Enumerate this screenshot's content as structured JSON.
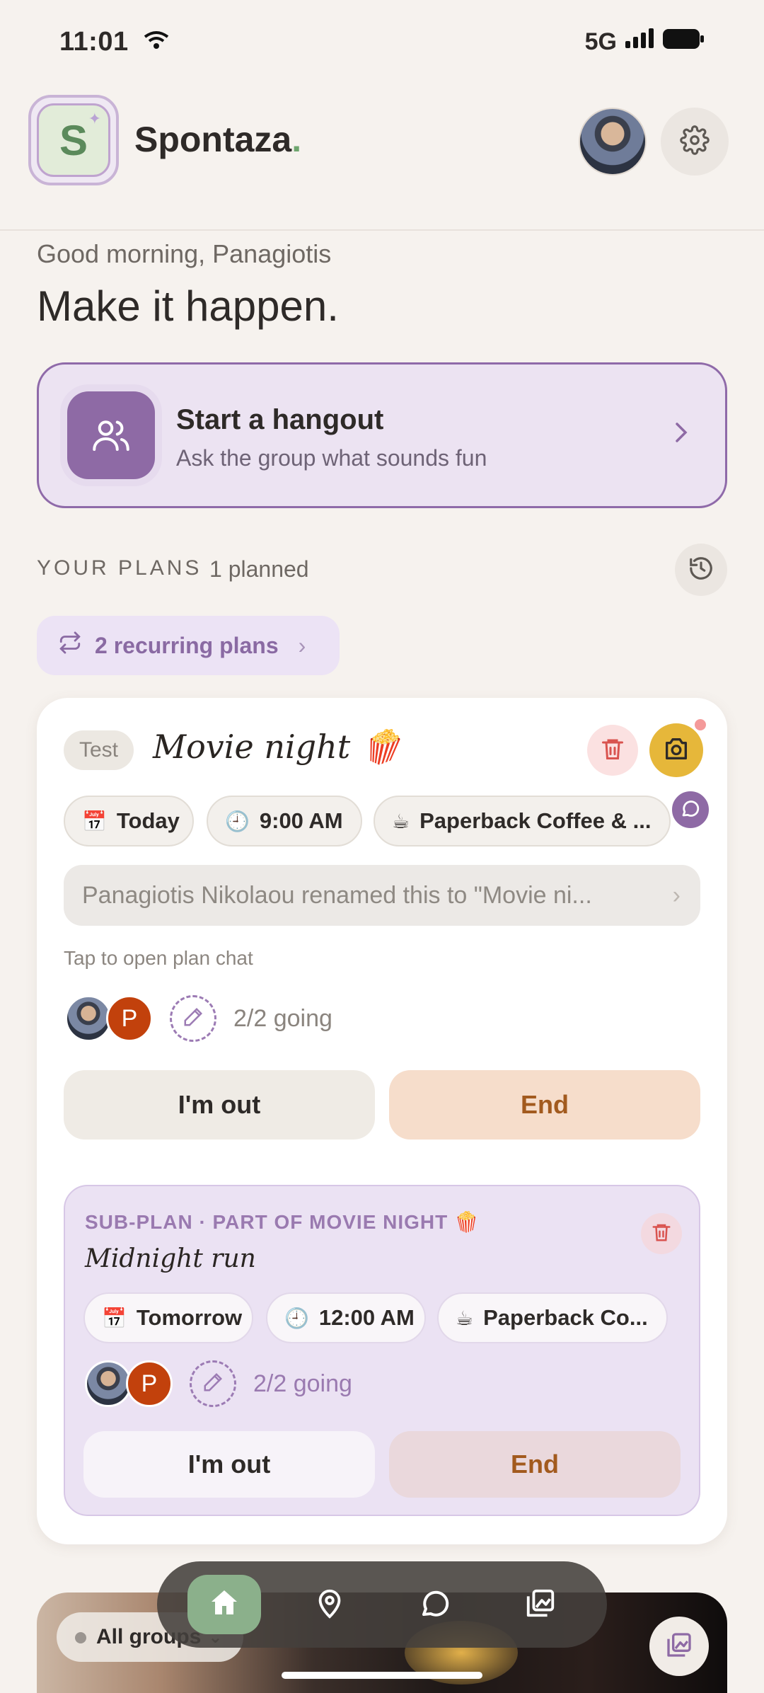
{
  "status_bar": {
    "time": "11:01",
    "network": "5G"
  },
  "header": {
    "logo_letter": "S",
    "brand_name": "Spontaza",
    "brand_dot": "."
  },
  "greeting": "Good morning, Panagiotis",
  "headline": "Make it happen.",
  "hangout": {
    "title": "Start a hangout",
    "subtitle": "Ask the group what sounds fun"
  },
  "plans": {
    "label": "YOUR PLANS",
    "count": "1 planned",
    "recurring_label": "2 recurring plans"
  },
  "plan_card": {
    "tag": "Test",
    "title": "Movie night 🍿",
    "date": "Today",
    "time": "9:00 AM",
    "place": "Paperback Coffee & ...",
    "date_emoji": "📅",
    "time_emoji": "🕘",
    "place_emoji": "☕",
    "activity": "Panagiotis Nikolaou renamed this to \"Movie ni...",
    "tap_hint": "Tap to open plan chat",
    "avatar_letter": "P",
    "going": "2/2 going",
    "out_label": "I'm out",
    "end_label": "End"
  },
  "subplan": {
    "label": "SUB-PLAN · PART OF MOVIE NIGHT 🍿",
    "title": "Midnight run",
    "date": "Tomorrow",
    "time": "12:00 AM",
    "place": "Paperback Co...",
    "avatar_letter": "P",
    "going": "2/2 going",
    "out_label": "I'm out",
    "end_label": "End"
  },
  "bottom": {
    "group_filter": "All groups"
  },
  "colors": {
    "accent": "#8e6aa5",
    "brand_green": "#6ea56e",
    "camera": "#e6b73a",
    "danger": "#d9534f",
    "nav_active": "#8bb08b"
  },
  "icons": [
    "wifi-icon",
    "signal-icon",
    "battery-icon",
    "gear-icon",
    "people-icon",
    "chevron-right-icon",
    "history-icon",
    "repeat-icon",
    "trash-icon",
    "camera-icon",
    "pencil-icon",
    "chat-icon",
    "home-icon",
    "map-pin-icon",
    "gallery-icon"
  ]
}
